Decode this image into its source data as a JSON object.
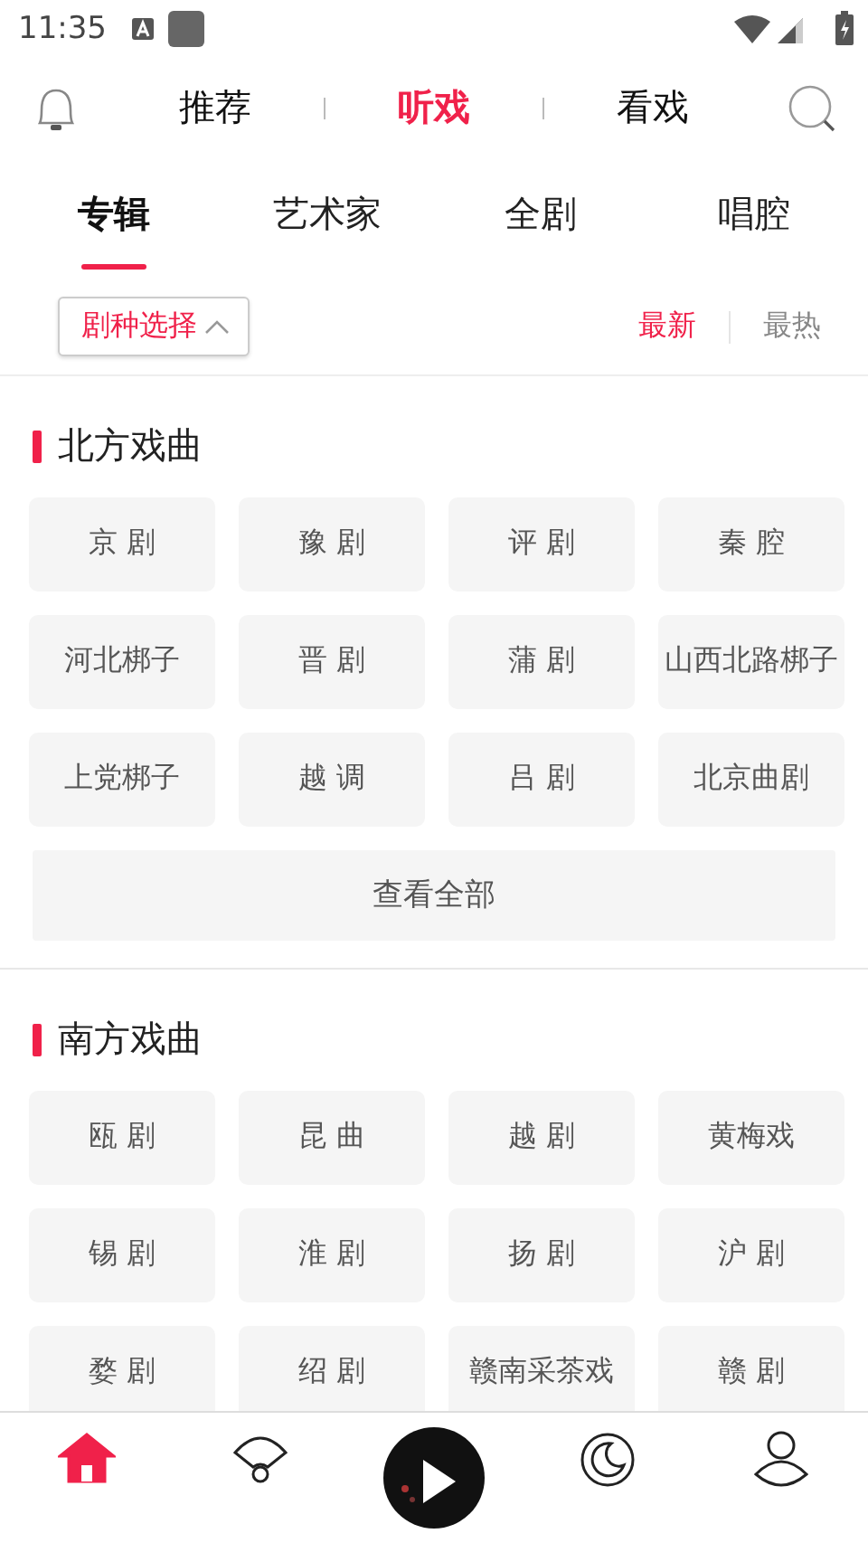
{
  "status_bar": {
    "time": "11:35"
  },
  "top_tabs": [
    {
      "label": "推荐",
      "selected": false
    },
    {
      "label": "听戏",
      "selected": true
    },
    {
      "label": "看戏",
      "selected": false
    }
  ],
  "sub_tabs": [
    {
      "label": "专辑",
      "selected": true
    },
    {
      "label": "艺术家",
      "selected": false
    },
    {
      "label": "全剧",
      "selected": false
    },
    {
      "label": "唱腔",
      "selected": false
    }
  ],
  "filter": {
    "label": "剧种选择",
    "expanded": true
  },
  "sort_options": [
    {
      "label": "最新",
      "selected": true
    },
    {
      "label": "最热",
      "selected": false
    }
  ],
  "sections": [
    {
      "title": "北方戏曲",
      "items": [
        "京 剧",
        "豫 剧",
        "评 剧",
        "秦 腔",
        "河北梆子",
        "晋 剧",
        "蒲 剧",
        "山西北路梆子",
        "上党梆子",
        "越 调",
        "吕 剧",
        "北京曲剧"
      ],
      "more_button": "查看全部"
    },
    {
      "title": "南方戏曲",
      "items": [
        "瓯 剧",
        "昆 曲",
        "越 剧",
        "黄梅戏",
        "锡 剧",
        "淮 剧",
        "扬 剧",
        "沪 剧",
        "婺 剧",
        "绍 剧",
        "赣南采茶戏",
        "赣 剧"
      ]
    }
  ],
  "bottom_nav": [
    {
      "kind": "home",
      "selected": true
    },
    {
      "kind": "fan",
      "selected": false
    },
    {
      "kind": "player",
      "selected": false
    },
    {
      "kind": "moon",
      "selected": false
    },
    {
      "kind": "profile",
      "selected": false
    }
  ]
}
